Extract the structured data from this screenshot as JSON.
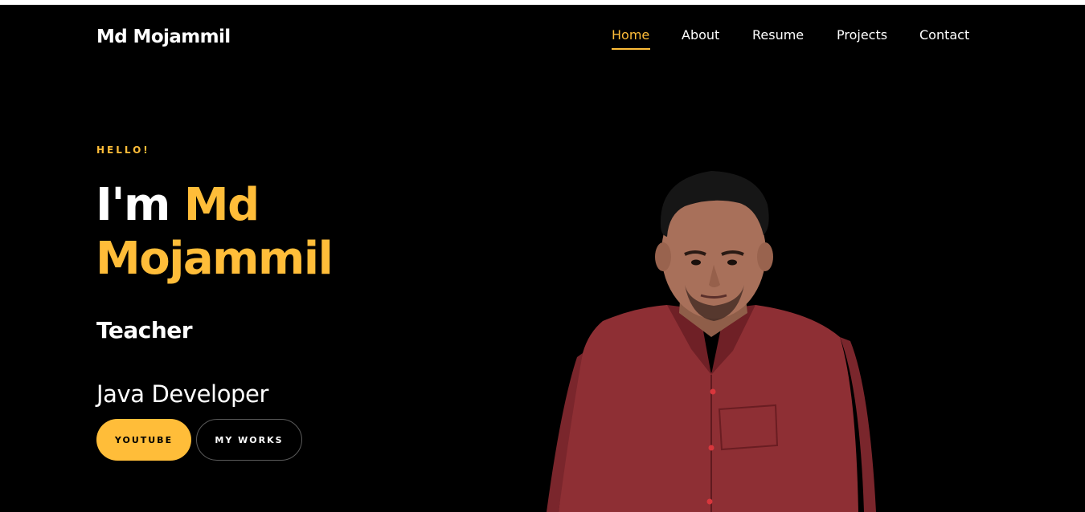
{
  "header": {
    "brand": "Md Mojammil",
    "nav": [
      {
        "label": "Home",
        "active": true
      },
      {
        "label": "About",
        "active": false
      },
      {
        "label": "Resume",
        "active": false
      },
      {
        "label": "Projects",
        "active": false
      },
      {
        "label": "Contact",
        "active": false
      }
    ]
  },
  "hero": {
    "greeting": "HELLO!",
    "im": "I'm",
    "name_line1": "Md",
    "name_line2": "Mojammil",
    "role1": "Teacher",
    "role2": "Java Developer",
    "buttons": {
      "youtube": "YOUTUBE",
      "works": "MY WORKS"
    }
  },
  "colors": {
    "accent": "#ffbd39",
    "background": "#000000",
    "text": "#ffffff",
    "shirt": "#8e2f34",
    "skin": "#a8705a",
    "hair": "#161616"
  }
}
